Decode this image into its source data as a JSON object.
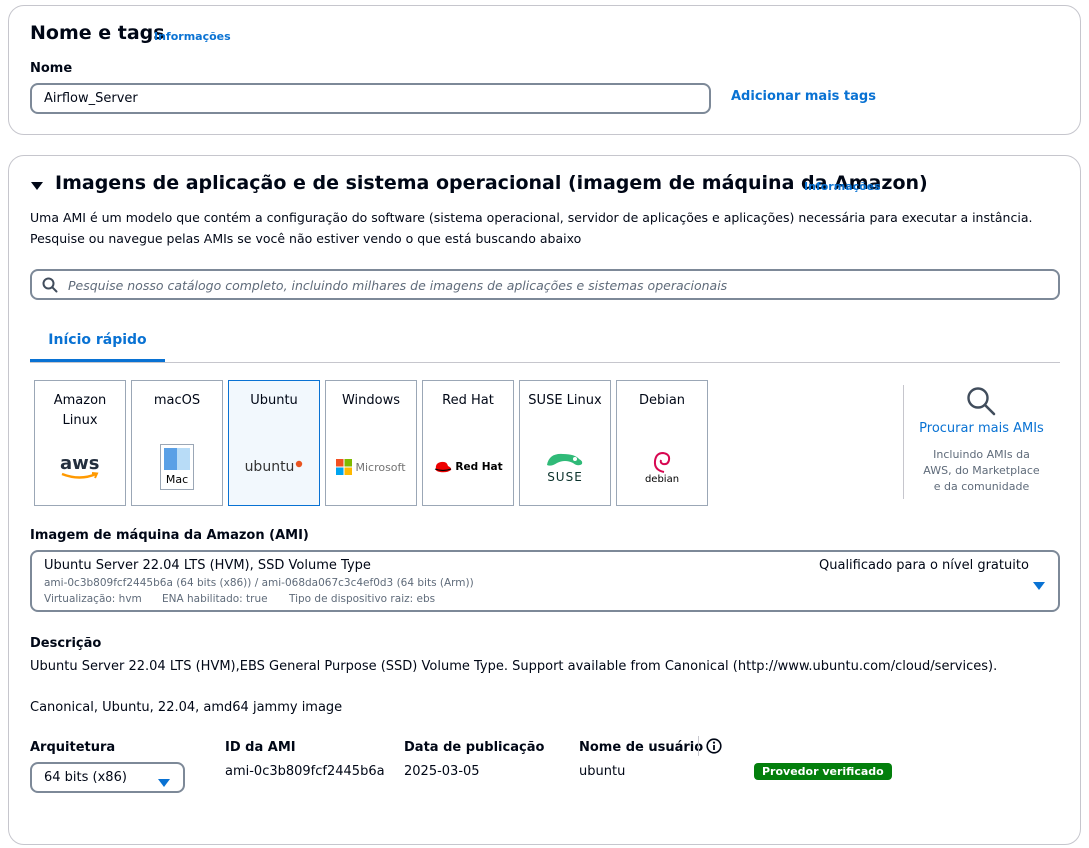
{
  "tags_section": {
    "title": "Nome e tags",
    "info_link": "Informações",
    "name_label": "Nome",
    "name_value": "Airflow_Server",
    "add_tags_link": "Adicionar mais tags"
  },
  "ami_section": {
    "title": "Imagens de aplicação e de sistema operacional (imagem de máquina da Amazon)",
    "info_link": "Informações",
    "description_line1": "Uma AMI é um modelo que contém a configuração do software (sistema operacional, servidor de aplicações e aplicações) necessária para executar a instância.",
    "description_line2": "Pesquise ou navegue pelas AMIs se você não estiver vendo o que está buscando abaixo",
    "search_placeholder": "Pesquise nosso catálogo completo, incluindo milhares de imagens de aplicações e sistemas operacionais",
    "tab_quick_start": "Início rápido",
    "tiles": [
      {
        "label": "Amazon Linux",
        "logo_text": "aws"
      },
      {
        "label": "macOS",
        "logo_text": "Mac"
      },
      {
        "label": "Ubuntu",
        "logo_text": "ubuntu"
      },
      {
        "label": "Windows",
        "logo_text": "Microsoft"
      },
      {
        "label": "Red Hat",
        "logo_text": "Red Hat"
      },
      {
        "label": "SUSE Linux",
        "logo_text": "SUSE"
      },
      {
        "label": "Debian",
        "logo_text": "debian"
      }
    ],
    "selected_tile": "Ubuntu",
    "browse_more_link": "Procurar mais AMIs",
    "browse_more_desc_line1": "Incluindo AMIs da",
    "browse_more_desc_line2": "AWS, do Marketplace",
    "browse_more_desc_line3": "e da comunidade",
    "ami_select_label": "Imagem de máquina da Amazon (AMI)",
    "ami_selected_name": "Ubuntu Server 22.04 LTS (HVM), SSD Volume Type",
    "ami_ids_line": "ami-0c3b809fcf2445b6a (64 bits (x86)) / ami-068da067c3c4ef0d3 (64 bits (Arm))",
    "ami_virtualization": "Virtualização: hvm",
    "ami_ena": "ENA habilitado: true",
    "ami_root_device": "Tipo de dispositivo raiz: ebs",
    "free_tier_label": "Qualificado para o nível gratuito",
    "description_label": "Descrição",
    "description_text": "Ubuntu Server 22.04 LTS (HVM),EBS General Purpose (SSD) Volume Type. Support available from Canonical (http://www.ubuntu.com/cloud/services).",
    "description_text2": "Canonical, Ubuntu, 22.04, amd64 jammy image",
    "architecture_label": "Arquitetura",
    "architecture_value": "64 bits (x86)",
    "ami_id_label": "ID da AMI",
    "ami_id_value": "ami-0c3b809fcf2445b6a",
    "publish_date_label": "Data de publicação",
    "publish_date_value": "2025-03-05",
    "username_label": "Nome de usuário",
    "username_value": "ubuntu",
    "verified_badge": "Provedor verificado"
  },
  "colors": {
    "link": "#0972d3",
    "badge_green": "#037f0c",
    "border": "#7d8998",
    "selected_bg": "#f2f8fd"
  }
}
